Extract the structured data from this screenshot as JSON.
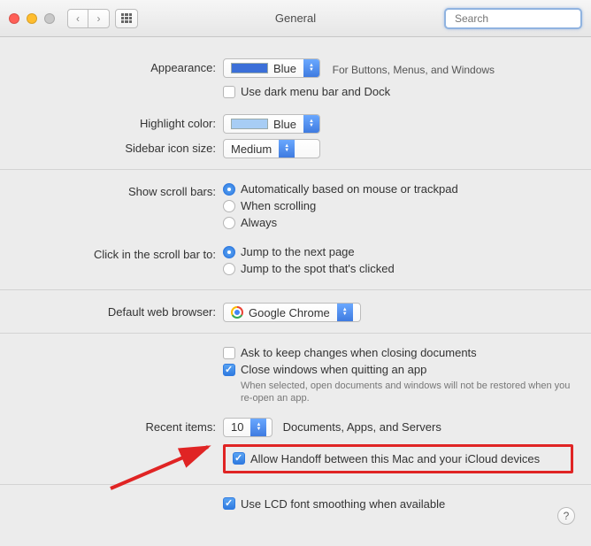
{
  "window": {
    "title": "General"
  },
  "search": {
    "placeholder": "Search"
  },
  "appearance": {
    "label": "Appearance:",
    "value": "Blue",
    "swatch": "#3b6fd8",
    "hint": "For Buttons, Menus, and Windows",
    "dark_menu": {
      "checked": false,
      "label": "Use dark menu bar and Dock"
    }
  },
  "highlight": {
    "label": "Highlight color:",
    "value": "Blue",
    "swatch": "#a7cdf5"
  },
  "sidebar": {
    "label": "Sidebar icon size:",
    "value": "Medium"
  },
  "scrollbars": {
    "label": "Show scroll bars:",
    "selected": 0,
    "options": [
      "Automatically based on mouse or trackpad",
      "When scrolling",
      "Always"
    ]
  },
  "scrollclick": {
    "label": "Click in the scroll bar to:",
    "selected": 0,
    "options": [
      "Jump to the next page",
      "Jump to the spot that's clicked"
    ]
  },
  "browser": {
    "label": "Default web browser:",
    "value": "Google Chrome"
  },
  "docs": {
    "ask": {
      "checked": false,
      "label": "Ask to keep changes when closing documents"
    },
    "close": {
      "checked": true,
      "label": "Close windows when quitting an app",
      "hint": "When selected, open documents and windows will not be restored when you re-open an app."
    }
  },
  "recent": {
    "label": "Recent items:",
    "value": "10",
    "suffix": "Documents, Apps, and Servers"
  },
  "handoff": {
    "checked": true,
    "label": "Allow Handoff between this Mac and your iCloud devices"
  },
  "lcd": {
    "checked": true,
    "label": "Use LCD font smoothing when available"
  },
  "help": "?"
}
